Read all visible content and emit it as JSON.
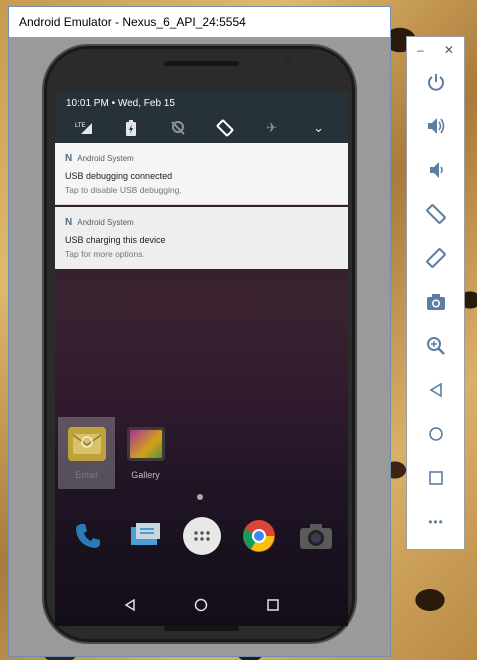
{
  "window": {
    "title": "Android Emulator - Nexus_6_API_24:5554"
  },
  "status": {
    "time_date": "10:01 PM • Wed, Feb 15"
  },
  "quick_settings": {
    "tiles": [
      {
        "icon": "lte-signal-icon",
        "glyph": "LTE"
      },
      {
        "icon": "battery-icon",
        "glyph": ""
      },
      {
        "icon": "location-off-icon",
        "glyph": ""
      },
      {
        "icon": "auto-rotate-icon",
        "glyph": ""
      },
      {
        "icon": "airplane-mode-icon",
        "glyph": "✈"
      },
      {
        "icon": "expand-icon",
        "glyph": "⌄"
      }
    ]
  },
  "notifications": [
    {
      "app": "Android System",
      "title": "USB debugging connected",
      "text": "Tap to disable USB debugging."
    },
    {
      "app": "Android System",
      "title": "USB charging this device",
      "text": "Tap for more options."
    }
  ],
  "home": {
    "apps": [
      {
        "label": "Email",
        "icon": "email-icon"
      },
      {
        "label": "Gallery",
        "icon": "gallery-icon"
      }
    ],
    "dock": [
      "phone-icon",
      "messages-icon",
      "app-drawer-icon",
      "chrome-icon",
      "camera-icon"
    ]
  },
  "toolbar": {
    "window_controls": {
      "minimize": "–",
      "close": "✕"
    },
    "buttons": [
      "power-icon",
      "volume-up-icon",
      "volume-down-icon",
      "rotate-left-icon",
      "rotate-right-icon",
      "screenshot-icon",
      "zoom-icon",
      "back-icon",
      "home-icon",
      "overview-icon",
      "more-icon"
    ],
    "more_glyph": "•••"
  },
  "colors": {
    "accent": "#5b7ea3",
    "qs_background": "#263238",
    "notification_background": "#f5f5f5"
  }
}
